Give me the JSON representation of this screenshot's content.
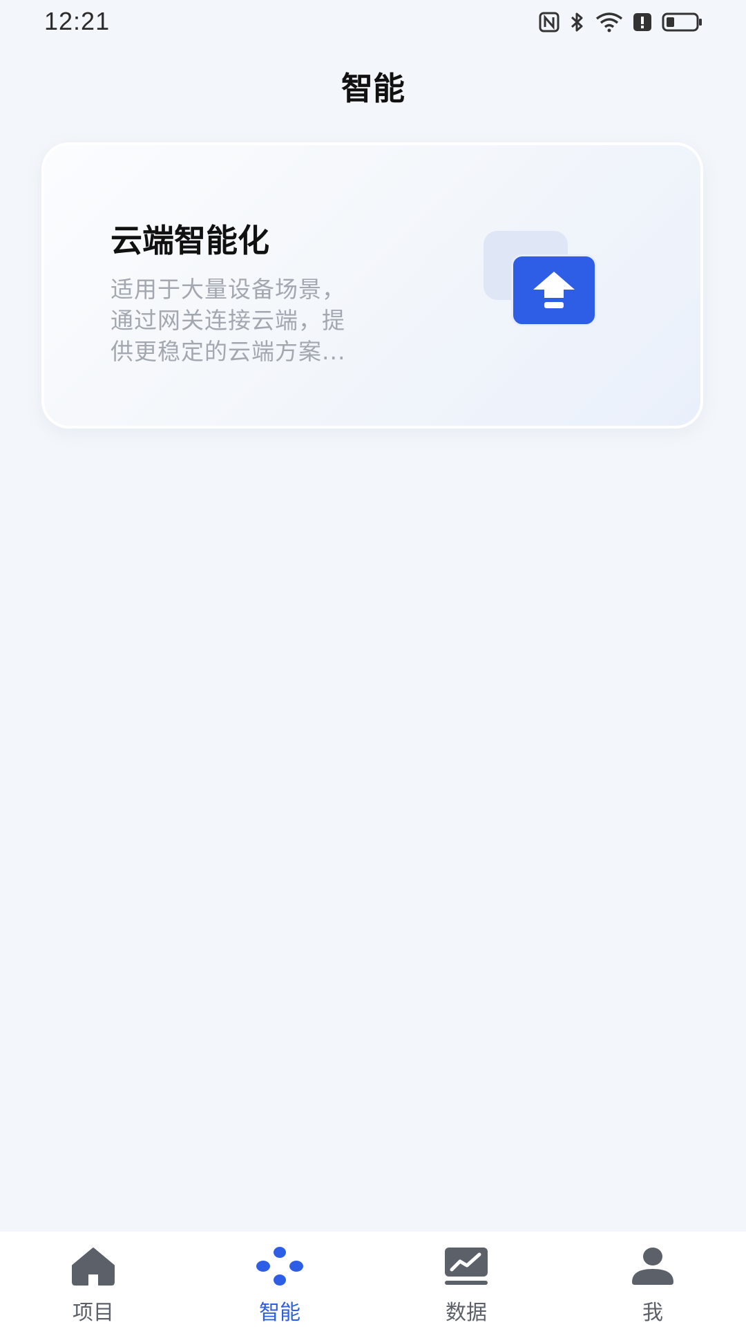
{
  "status_bar": {
    "time": "12:21",
    "icons": [
      "nfc-icon",
      "bluetooth-icon",
      "wifi-icon",
      "alert-icon",
      "battery-icon"
    ]
  },
  "header": {
    "title": "智能"
  },
  "card": {
    "title": "云端智能化",
    "description_lines": [
      "适用于大量设备场景，",
      "通过网关连接云端，提",
      "供更稳定的云端方案..."
    ],
    "icon": "cloud-upload-icon"
  },
  "bottom_nav": {
    "items": [
      {
        "label": "项目",
        "icon": "home-icon"
      },
      {
        "label": "智能",
        "icon": "smart-dots-icon"
      },
      {
        "label": "数据",
        "icon": "chart-icon"
      },
      {
        "label": "我",
        "icon": "person-icon"
      }
    ],
    "active_index": 1
  },
  "colors": {
    "background": "#f3f6fa",
    "accent": "#2f5ee6",
    "nav_inactive": "#5b6069",
    "description": "#a3a8b0"
  }
}
